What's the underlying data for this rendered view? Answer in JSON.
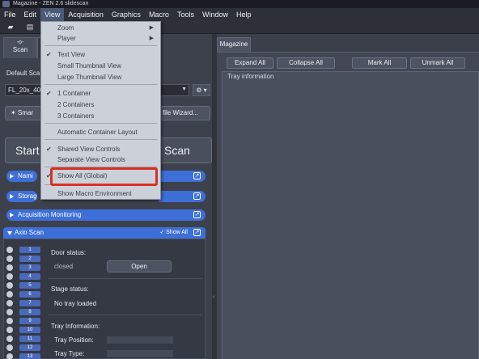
{
  "window": {
    "title": "Magazine - ZEN 2.6 slidescan"
  },
  "menubar": {
    "items": [
      "File",
      "Edit",
      "View",
      "Acquisition",
      "Graphics",
      "Macro",
      "Tools",
      "Window",
      "Help"
    ],
    "active": "View"
  },
  "left_panel": {
    "tabs": [
      {
        "label": "Scan",
        "glyph": "-o-"
      },
      {
        "label": "",
        "glyph": ""
      }
    ],
    "default_label": "Default Sca",
    "profile_value": "FL_20x_405",
    "gear_label": "⚙ ▾",
    "smart_label": "Smar",
    "wizard_label": "file Wizard...",
    "start_label": "Start",
    "scan_label": "Scan",
    "sections": [
      "Nami",
      "Storag",
      "Acquisition Monitoring"
    ],
    "axio": {
      "header": "Axio Scan",
      "show_all": "✓ Show All",
      "slots": [
        "1",
        "2",
        "3",
        "4",
        "5",
        "6",
        "7",
        "8",
        "9",
        "10",
        "11",
        "12",
        "13"
      ],
      "door_status_label": "Door status:",
      "door_status_value": "closed",
      "open_button": "Open",
      "stage_status_label": "Stage status:",
      "stage_status_value": "No tray loaded",
      "tray_info_label": "Tray Information:",
      "tray_position_label": "Tray Position:",
      "tray_type_label": "Tray Type:"
    }
  },
  "view_menu": {
    "items": [
      {
        "label": "Zoom",
        "submenu": true,
        "checked": false
      },
      {
        "label": "Player",
        "submenu": true,
        "checked": false
      },
      {
        "label": "Text View",
        "checked": true
      },
      {
        "label": "Small Thumbnail View",
        "checked": false
      },
      {
        "label": "Large Thumbnail View",
        "checked": false
      },
      {
        "label": "1 Container",
        "checked": true
      },
      {
        "label": "2 Containers",
        "checked": false
      },
      {
        "label": "3 Containers",
        "checked": false
      },
      {
        "label": "Automatic Container Layout",
        "checked": false
      },
      {
        "label": "Shared View Controls",
        "checked": true
      },
      {
        "label": "Separate View Controls",
        "checked": false
      },
      {
        "label": "Show All (Global)",
        "checked": true,
        "highlighted": true
      },
      {
        "label": "Show Macro Environment",
        "checked": false
      }
    ]
  },
  "right_panel": {
    "tab": "Magazine",
    "buttons": [
      "Expand All",
      "Collapse All",
      "Mark All",
      "Unmark All"
    ],
    "tray_header": "Tray information"
  },
  "colors": {
    "accent": "#3e6fd8",
    "highlight_box": "#d93025"
  }
}
